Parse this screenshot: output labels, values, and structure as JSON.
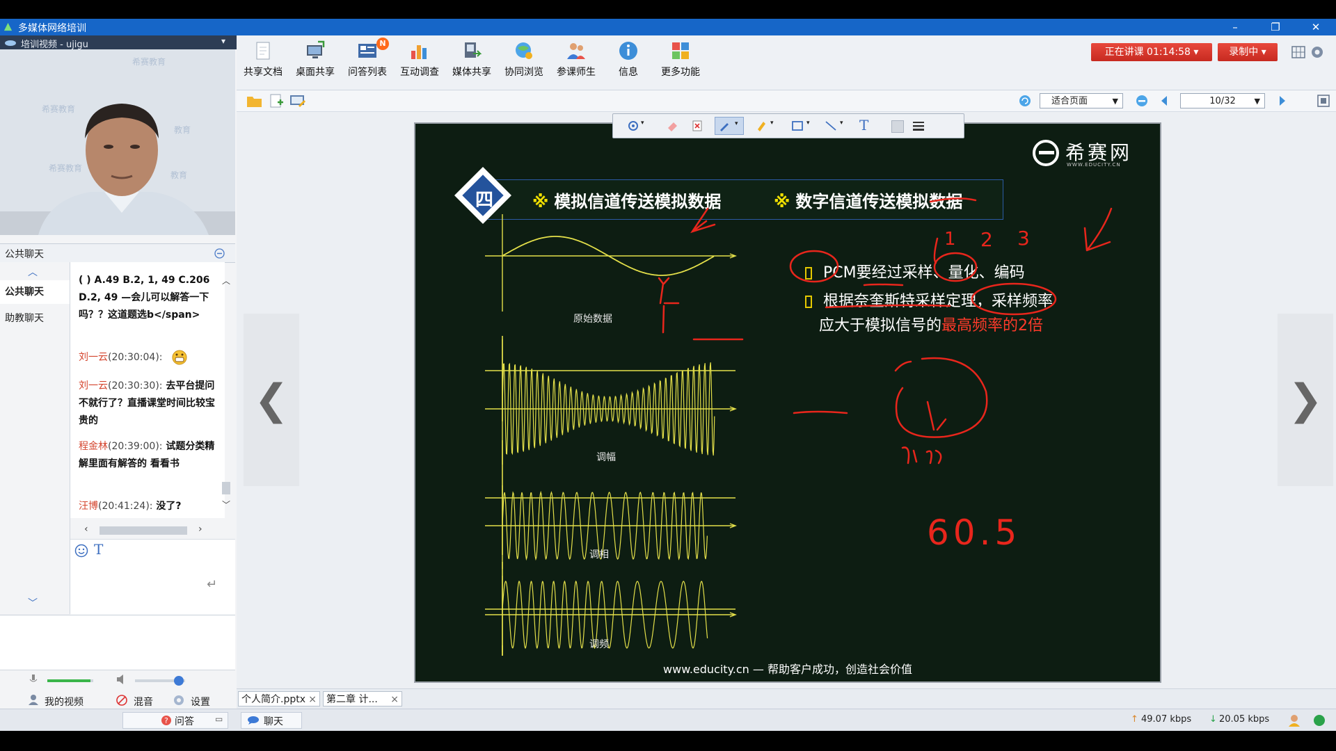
{
  "app": {
    "title": "多媒体网络培训"
  },
  "video": {
    "header": "培训视频 - ujigu"
  },
  "chat": {
    "header": "公共聊天",
    "tabs": [
      "公共聊天",
      "助教聊天"
    ],
    "messages": [
      {
        "text": "( ) A.49 B.2, 1, 49 C.206 D.2, 49 —会儿可以解答一下吗？？这道题选b</span>"
      },
      {
        "user": "刘一云",
        "time": "(20:30:04):",
        "text": ""
      },
      {
        "user": "刘一云",
        "time": "(20:30:30):",
        "text": "去平台提问不就行了？直播课堂时间比较宝贵的"
      },
      {
        "user": "程金林",
        "time": "(20:39:00):",
        "text": "试题分类精解里面有解答的 看看书"
      },
      {
        "user": "汪博",
        "time": "(20:41:24):",
        "text": "没了?"
      }
    ],
    "emoji_icon": "grin-emoji-icon"
  },
  "controls": {
    "my_video": "我的视频",
    "mix": "混音",
    "settings": "设置",
    "qa": "问答",
    "chat": "聊天"
  },
  "toolbar": {
    "items": [
      {
        "label": "共享文档",
        "icon": "document-icon"
      },
      {
        "label": "桌面共享",
        "icon": "desktop-share-icon"
      },
      {
        "label": "问答列表",
        "icon": "qa-list-icon",
        "badge": "N"
      },
      {
        "label": "互动调查",
        "icon": "poll-chart-icon"
      },
      {
        "label": "媒体共享",
        "icon": "media-share-icon"
      },
      {
        "label": "协同浏览",
        "icon": "co-browse-icon"
      },
      {
        "label": "参课师生",
        "icon": "participants-icon"
      },
      {
        "label": "信息",
        "icon": "info-icon"
      },
      {
        "label": "更多功能",
        "icon": "more-apps-icon"
      }
    ],
    "live_status": "正在讲课 01:14:58",
    "record_status": "录制中"
  },
  "view": {
    "fit_mode": "适合页面",
    "page": "10/32"
  },
  "slide": {
    "logo_text": "希赛网",
    "logo_sub": "WWW.EDUCITY.CN",
    "section_number": "四",
    "title_left": "模拟信道传送模拟数据",
    "title_right": "数字信道传送模拟数据",
    "title_mark": "※",
    "bullet1": "PCM要经过采样、量化、编码",
    "bullet2_line1": "根据奈奎斯特采样定理，采样频率",
    "bullet2_line2_prefix": "应大于模拟信号的",
    "bullet2_line2_red": "最高频率的2倍",
    "wave_labels": [
      "原始数据",
      "调幅",
      "调相",
      "调频"
    ],
    "footer": "www.educity.cn — 帮助客户成功，创造社会价值",
    "handwriting": [
      "1",
      "2",
      "3",
      "60.5"
    ]
  },
  "doc_tabs": [
    "个人简介.pptx",
    "第二章 计..."
  ],
  "status": {
    "upload": "49.07 kbps",
    "download": "20.05 kbps"
  },
  "colors": {
    "titlebar": "#1666c8",
    "slide_bg": "#0d1d12",
    "accent_yellow": "#f1e000",
    "annotation_red": "#e8261c",
    "live_red": "#d9342a"
  }
}
